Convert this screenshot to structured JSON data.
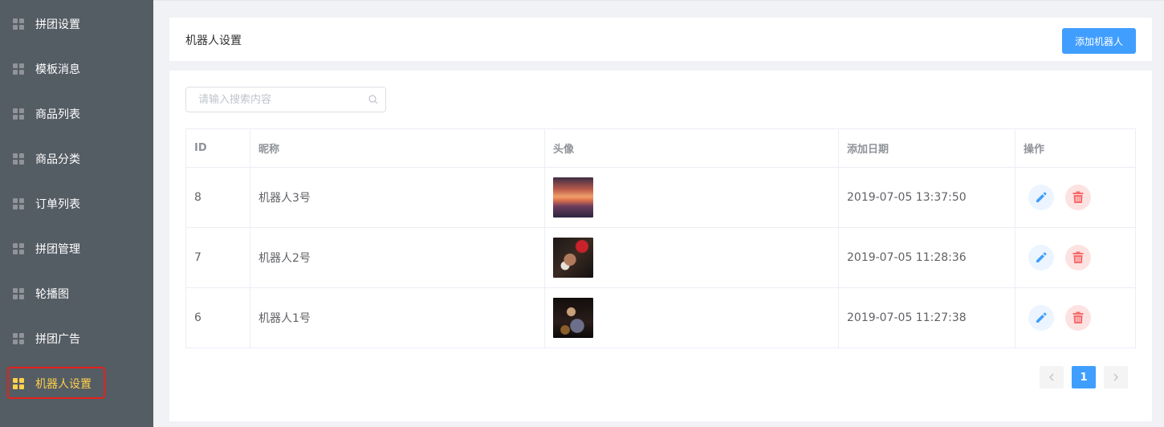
{
  "sidebar": {
    "items": [
      {
        "label": "拼团设置"
      },
      {
        "label": "模板消息"
      },
      {
        "label": "商品列表"
      },
      {
        "label": "商品分类"
      },
      {
        "label": "订单列表"
      },
      {
        "label": "拼团管理"
      },
      {
        "label": "轮播图"
      },
      {
        "label": "拼团广告"
      },
      {
        "label": "机器人设置",
        "active": true
      }
    ]
  },
  "header": {
    "title": "机器人设置",
    "add_button_label": "添加机器人"
  },
  "search": {
    "placeholder": "请输入搜索内容",
    "value": ""
  },
  "table": {
    "columns": [
      "ID",
      "昵称",
      "头像",
      "添加日期",
      "操作"
    ],
    "rows": [
      {
        "id": "8",
        "nickname": "机器人3号",
        "date": "2019-07-05 13:37:50"
      },
      {
        "id": "7",
        "nickname": "机器人2号",
        "date": "2019-07-05 11:28:36"
      },
      {
        "id": "6",
        "nickname": "机器人1号",
        "date": "2019-07-05 11:27:38"
      }
    ]
  },
  "pagination": {
    "current_page": "1"
  },
  "colors": {
    "sidebar_bg": "#545c64",
    "active": "#ffd04b",
    "primary": "#409eff",
    "danger": "#f56c6c"
  }
}
